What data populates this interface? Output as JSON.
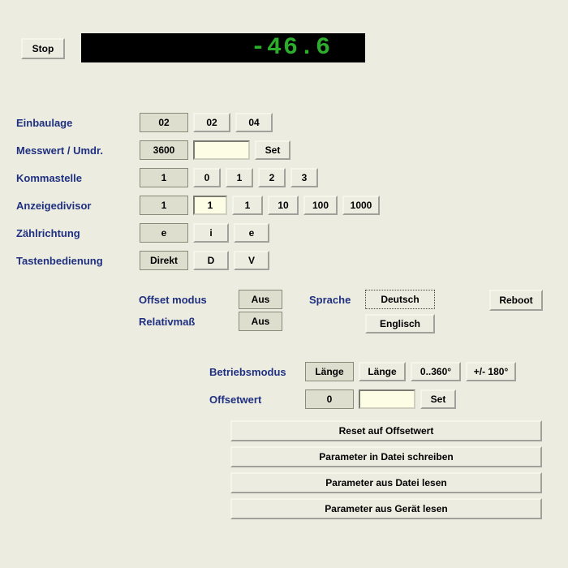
{
  "stop": "Stop",
  "display": "-46.6",
  "labels": {
    "einbaulage": "Einbaulage",
    "messwert": "Messwert / Umdr.",
    "kommastelle": "Kommastelle",
    "anzeigedivisor": "Anzeigedivisor",
    "zaehlrichtung": "Zählrichtung",
    "tastenbedienung": "Tastenbedienung",
    "offsetmodus": "Offset modus",
    "relativmass": "Relativmaß",
    "sprache": "Sprache",
    "betriebsmodus": "Betriebsmodus",
    "offsetwert": "Offsetwert"
  },
  "einbaulage": {
    "value": "02",
    "options": [
      "02",
      "04"
    ]
  },
  "messwert": {
    "value": "3600",
    "input": "",
    "set": "Set"
  },
  "kommastelle": {
    "value": "1",
    "options": [
      "0",
      "1",
      "2",
      "3"
    ]
  },
  "anzeigedivisor": {
    "value": "1",
    "input": "1",
    "options": [
      "1",
      "10",
      "100",
      "1000"
    ]
  },
  "zaehlrichtung": {
    "value": "e",
    "options": [
      "i",
      "e"
    ]
  },
  "tastenbedienung": {
    "value": "Direkt",
    "options": [
      "D",
      "V"
    ]
  },
  "offsetmodus": {
    "value": "Aus"
  },
  "relativmass": {
    "value": "Aus"
  },
  "sprache": {
    "options": [
      "Deutsch",
      "Englisch"
    ]
  },
  "reboot": "Reboot",
  "betriebsmodus": {
    "value": "Länge",
    "options": [
      "Länge",
      "0..360°",
      "+/- 180°"
    ]
  },
  "offsetwert": {
    "value": "0",
    "input": "",
    "set": "Set"
  },
  "longbuttons": [
    "Reset auf Offsetwert",
    "Parameter in Datei schreiben",
    "Parameter aus Datei lesen",
    "Parameter aus Gerät lesen"
  ]
}
